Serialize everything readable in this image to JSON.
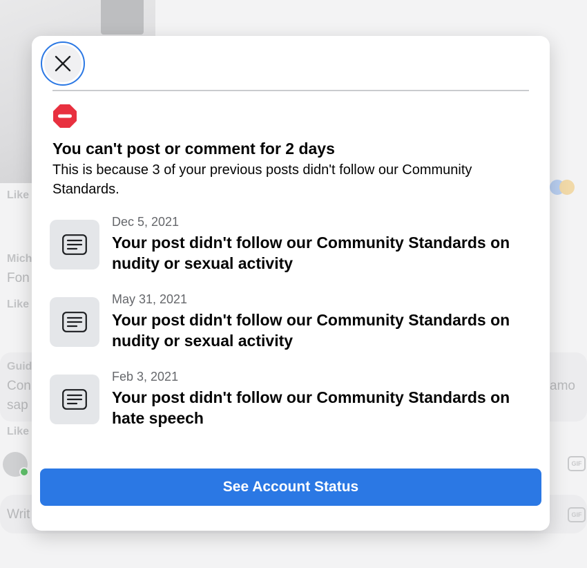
{
  "background": {
    "like_labels": [
      "Like",
      "Like",
      "Like"
    ],
    "commenters": [
      "Mich",
      "Guid"
    ],
    "comment_snippets": [
      "Fon",
      "Con",
      "sap",
      "amo"
    ],
    "write_placeholder": "Writ",
    "gif_label": "GIF"
  },
  "modal": {
    "close_icon": "close-icon",
    "status_icon": "no-entry-icon",
    "status_icon_color": "#e8303f",
    "title": "You can't post or comment for 2 days",
    "subtitle": "This is because 3 of your previous posts didn't follow our Community Standards.",
    "violations": [
      {
        "icon": "document-icon",
        "date": "Dec 5, 2021",
        "description": "Your post didn't follow our Community Standards on nudity or sexual activity"
      },
      {
        "icon": "document-icon",
        "date": "May 31, 2021",
        "description": "Your post didn't follow our Community Standards on nudity or sexual activity"
      },
      {
        "icon": "document-icon",
        "date": "Feb 3, 2021",
        "description": "Your post didn't follow our Community Standards on hate speech"
      }
    ],
    "cta_label": "See Account Status",
    "accent_color": "#2b78e4"
  }
}
